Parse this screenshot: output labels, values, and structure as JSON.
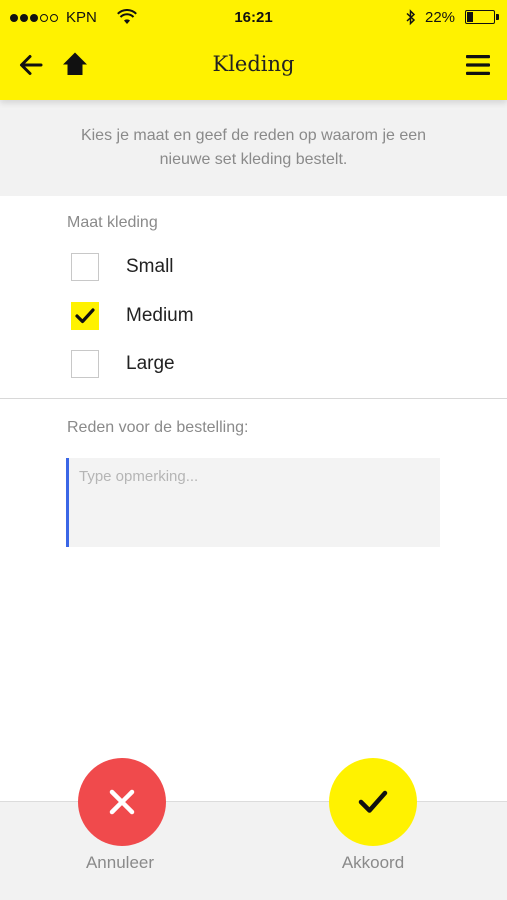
{
  "status_bar": {
    "carrier": "KPN",
    "time": "16:21",
    "battery_percent": "22%",
    "battery_level": 0.22,
    "signal_bars_filled": 3,
    "signal_bars_total": 5
  },
  "header": {
    "title": "Kleding",
    "back_icon": "arrow-left-icon",
    "home_icon": "home-icon",
    "menu_icon": "hamburger-menu-icon",
    "background_color": "#fff200"
  },
  "intro": {
    "text": "Kies je maat en geef de reden op waarom je een nieuwe set kleding bestelt."
  },
  "size_section": {
    "label": "Maat kleding",
    "options": [
      {
        "label": "Small",
        "checked": false
      },
      {
        "label": "Medium",
        "checked": true
      },
      {
        "label": "Large",
        "checked": false
      }
    ]
  },
  "reason_section": {
    "label": "Reden voor de bestelling:",
    "placeholder": "Type opmerking...",
    "value": ""
  },
  "footer": {
    "cancel_label": "Annuleer",
    "cancel_color": "#f04a4c",
    "accept_label": "Akkoord",
    "accept_color": "#fff200"
  }
}
